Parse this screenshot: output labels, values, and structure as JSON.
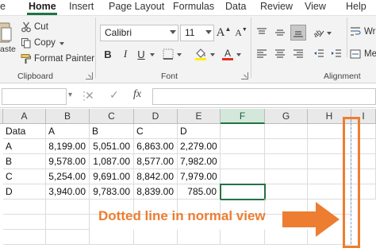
{
  "menu": {
    "tabs": [
      "e",
      "Home",
      "Insert",
      "Page Layout",
      "Formulas",
      "Data",
      "Review",
      "View",
      "Help"
    ],
    "active": "Home"
  },
  "clipboard": {
    "cut_label": "Cut",
    "copy_label": "Copy",
    "format_painter_label": "Format Painter",
    "paste_label": "aste",
    "group_label": "Clipboard"
  },
  "font": {
    "name": "Calibri",
    "size": "11",
    "bold_label": "B",
    "italic_label": "I",
    "underline_label": "U",
    "grow_label": "A",
    "shrink_label": "A",
    "group_label": "Font"
  },
  "alignment": {
    "wrap_label": "Wra",
    "merge_label": "Mer",
    "group_label": "Alignment"
  },
  "formula_bar": {
    "cancel_glyph": "✕",
    "enter_glyph": "✓",
    "fx_label": "fx",
    "name_box_value": "",
    "formula_value": ""
  },
  "grid": {
    "columns": [
      "A",
      "B",
      "C",
      "D",
      "E",
      "F",
      "G",
      "H",
      "I"
    ],
    "selected_column": "F",
    "rows": [
      [
        "Data",
        "A",
        "B",
        "C",
        "D",
        "",
        "",
        "",
        ""
      ],
      [
        "A",
        "8,199.00",
        "5,051.00",
        "6,863.00",
        "2,279.00",
        "",
        "",
        "",
        ""
      ],
      [
        "B",
        "9,578.00",
        "1,087.00",
        "8,577.00",
        "7,982.00",
        "",
        "",
        "",
        ""
      ],
      [
        "C",
        "5,254.00",
        "9,691.00",
        "8,842.00",
        "7,979.00",
        "",
        "",
        "",
        ""
      ],
      [
        "D",
        "3,940.00",
        "9,783.00",
        "8,839.00",
        "785.00",
        "",
        "",
        "",
        ""
      ]
    ]
  },
  "annotation": {
    "text": "Dotted line in normal view",
    "color": "#ed7d31",
    "page_break_color": "#7e9ac9"
  },
  "colors": {
    "accent": "#217346",
    "font_color": "#e0301e",
    "highlight_color": "#ffef00"
  }
}
